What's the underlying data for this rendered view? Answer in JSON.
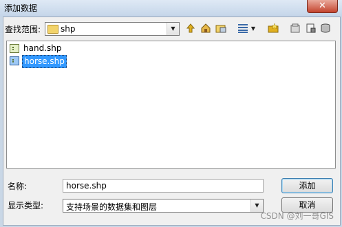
{
  "window": {
    "title": "添加数据",
    "close_glyph": "✕"
  },
  "lookin": {
    "label": "查找范围:",
    "value": "shp",
    "dropdown_glyph": "▼"
  },
  "toolbar": {
    "up_icon": "up-one-level-icon",
    "home_icon": "home-folder-icon",
    "connect_icon": "connect-to-folder-icon",
    "view_icon": "list-view-icon",
    "view_dropdown": "▼",
    "new_folder_icon": "new-folder-icon",
    "catalog_icon": "catalog-icon",
    "newfile_icon": "new-file-icon",
    "db_icon": "database-icon"
  },
  "files": [
    {
      "name": "hand.shp",
      "selected": false
    },
    {
      "name": "horse.shp",
      "selected": true
    }
  ],
  "name_field": {
    "label": "名称:",
    "value": "horse.shp"
  },
  "type_field": {
    "label": "显示类型:",
    "value": "支持场景的数据集和图层",
    "dropdown_glyph": "▼"
  },
  "buttons": {
    "add": "添加",
    "cancel": "取消"
  },
  "watermark": "CSDN @刘一哥GIS"
}
